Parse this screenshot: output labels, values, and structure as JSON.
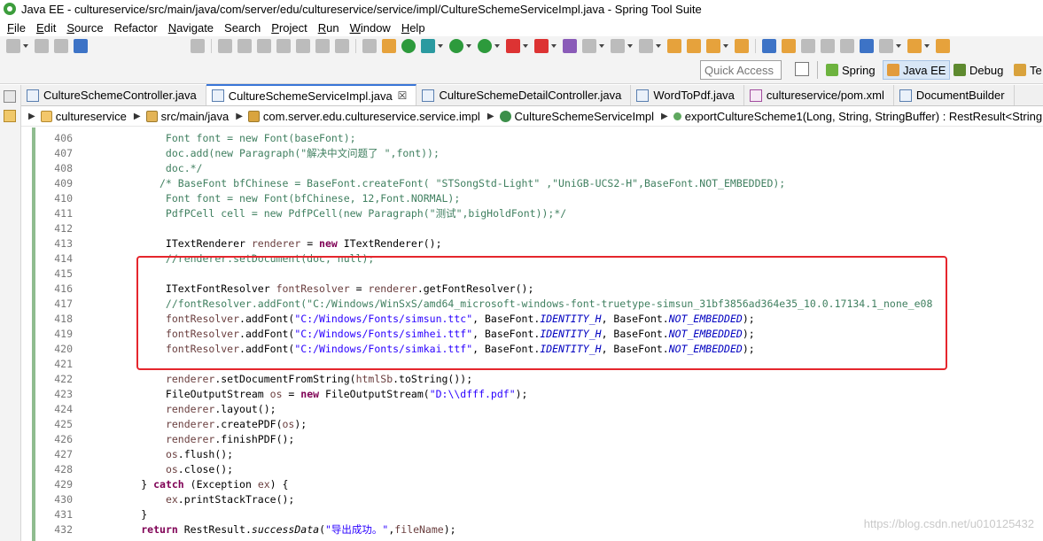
{
  "window": {
    "title": "Java EE - cultureservice/src/main/java/com/server/edu/cultureservice/service/impl/CultureSchemeServiceImpl.java - Spring Tool Suite"
  },
  "menu": [
    {
      "label": "File",
      "mnemonic": "F",
      "rest": "ile"
    },
    {
      "label": "Edit",
      "mnemonic": "E",
      "rest": "dit"
    },
    {
      "label": "Source",
      "mnemonic": "S",
      "rest": "ource"
    },
    {
      "label": "Refactor",
      "mnemonic": "",
      "rest": "Refactor"
    },
    {
      "label": "Navigate",
      "mnemonic": "N",
      "rest": "avigate"
    },
    {
      "label": "Search",
      "mnemonic": "",
      "rest": "Search"
    },
    {
      "label": "Project",
      "mnemonic": "P",
      "rest": "roject"
    },
    {
      "label": "Run",
      "mnemonic": "R",
      "rest": "un"
    },
    {
      "label": "Window",
      "mnemonic": "W",
      "rest": "indow"
    },
    {
      "label": "Help",
      "mnemonic": "H",
      "rest": "elp"
    }
  ],
  "perspectives": {
    "quick_access_placeholder": "Quick Access",
    "spring": "Spring",
    "java_ee": "Java EE",
    "debug": "Debug",
    "te": "Te"
  },
  "tabs": [
    {
      "label": "CultureSchemeController.java",
      "active": false
    },
    {
      "label": "CultureSchemeServiceImpl.java",
      "active": true,
      "close": "☒"
    },
    {
      "label": "CultureSchemeDetailController.java",
      "active": false
    },
    {
      "label": "WordToPdf.java",
      "active": false
    },
    {
      "label": "cultureservice/pom.xml",
      "active": false
    },
    {
      "label": "DocumentBuilder",
      "active": false
    }
  ],
  "breadcrumb": [
    "cultureservice",
    "src/main/java",
    "com.server.edu.cultureservice.service.impl",
    "CultureSchemeServiceImpl",
    "exportCultureScheme1(Long, String, StringBuffer) : RestResult<String"
  ],
  "code_lines": [
    {
      "n": "406",
      "text": "              Font font = new Font(baseFont);"
    },
    {
      "n": "407",
      "text": "              doc.add(new Paragraph(\"解决中文问题了 \",font));"
    },
    {
      "n": "408",
      "text": "              doc.*/"
    },
    {
      "n": "409",
      "text": "             /* BaseFont bfChinese = BaseFont.createFont( \"STSongStd-Light\" ,\"UniGB-UCS2-H\",BaseFont.NOT_EMBEDDED);"
    },
    {
      "n": "410",
      "text": "              Font font = new Font(bfChinese, 12,Font.NORMAL);"
    },
    {
      "n": "411",
      "text": "              PdfPCell cell = new PdfPCell(new Paragraph(\"测试\",bigHoldFont));*/"
    },
    {
      "n": "412",
      "text": ""
    },
    {
      "n": "413",
      "text": "              ITextRenderer renderer = new ITextRenderer();"
    },
    {
      "n": "414",
      "text": "              //renderer.setDocument(doc, null);"
    },
    {
      "n": "415",
      "text": ""
    },
    {
      "n": "416",
      "text": "              ITextFontResolver fontResolver = renderer.getFontResolver();"
    },
    {
      "n": "417",
      "text": "              //fontResolver.addFont(\"C:/Windows/WinSxS/amd64_microsoft-windows-font-truetype-simsun_31bf3856ad364e35_10.0.17134.1_none_e08"
    },
    {
      "n": "418",
      "text": "              fontResolver.addFont(\"C:/Windows/Fonts/simsun.ttc\", BaseFont.IDENTITY_H, BaseFont.NOT_EMBEDDED);"
    },
    {
      "n": "419",
      "text": "              fontResolver.addFont(\"C:/Windows/Fonts/simhei.ttf\", BaseFont.IDENTITY_H, BaseFont.NOT_EMBEDDED);"
    },
    {
      "n": "420",
      "text": "              fontResolver.addFont(\"C:/Windows/Fonts/simkai.ttf\", BaseFont.IDENTITY_H, BaseFont.NOT_EMBEDDED);"
    },
    {
      "n": "421",
      "text": ""
    },
    {
      "n": "422",
      "text": "              renderer.setDocumentFromString(htmlSb.toString());"
    },
    {
      "n": "423",
      "text": "              FileOutputStream os = new FileOutputStream(\"D:\\\\dfff.pdf\");"
    },
    {
      "n": "424",
      "text": "              renderer.layout();"
    },
    {
      "n": "425",
      "text": "              renderer.createPDF(os);"
    },
    {
      "n": "426",
      "text": "              renderer.finishPDF();"
    },
    {
      "n": "427",
      "text": "              os.flush();"
    },
    {
      "n": "428",
      "text": "              os.close();"
    },
    {
      "n": "429",
      "text": "          } catch (Exception ex) {"
    },
    {
      "n": "430",
      "text": "              ex.printStackTrace();"
    },
    {
      "n": "431",
      "text": "          }"
    },
    {
      "n": "432",
      "text": "          return RestResult.successData(\"导出成功。\",fileName);"
    }
  ],
  "watermark": "https://blog.csdn.net/u010125432",
  "colors": {
    "highlight_box": "#e5262d",
    "keyword": "#7f0055",
    "string": "#2a00ff",
    "comment": "#3f7f5f",
    "static_field": "#0000c0",
    "active_tab_accent": "#3875d7"
  }
}
